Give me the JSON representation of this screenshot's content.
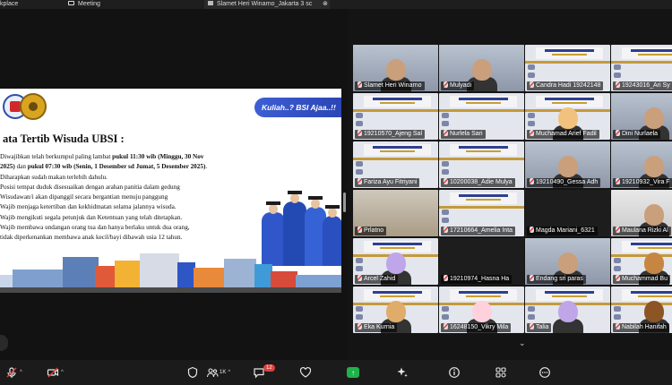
{
  "tabs": {
    "first_label": "kplace",
    "meeting_label": "Meeting",
    "share_label": "Slamet Heri Winarno_Jakarta 3 sc"
  },
  "slide": {
    "slogan": "Kuliah..? BSI Ajaa..!!",
    "title": "ata Tertib Wisuda UBSI :",
    "rules": [
      {
        "pre": "Diwajibkan telah berkumpul paling lambat ",
        "bold": "pukul 11:30 wib (Minggu, 30 Nov",
        "post": ""
      },
      {
        "pre": "",
        "bold": "2025)",
        "mid": " dan ",
        "bold2": "pukul 07:30 wib (Senin, 1 Desember sd Jumat, 5 Desember 2025)",
        "post": "."
      },
      {
        "pre": "Diharapkan sudah makan terlebih dahulu.",
        "bold": "",
        "post": ""
      },
      {
        "pre": "Posisi tempat duduk disesuaikan dengan arahan panitia dalam gedung",
        "bold": "",
        "post": ""
      },
      {
        "pre": "Wisudawan/i akan dipanggil secara bergantian menuju panggung",
        "bold": "",
        "post": ""
      },
      {
        "pre": "Wajib menjaga ketertiban dan kekhidmatan selama jalannya wisuda.",
        "bold": "",
        "post": ""
      },
      {
        "pre": "Wajib mengikuti segala petunjuk dan Ketentuan yang telah ditetapkan.",
        "bold": "",
        "post": ""
      },
      {
        "pre": "Wajib membawa undangan orang tua dan hanya berlaku untuk dua orang,",
        "bold": "",
        "post": ""
      },
      {
        "pre": "tidak diperkenankan membawa anak kecil/bayi dibawah usia 12 tahun.",
        "bold": "",
        "post": ""
      }
    ]
  },
  "participants": [
    {
      "name": "Slamet Heri Winarno",
      "kind": "person",
      "speaking": true
    },
    {
      "name": "Mulyadi",
      "kind": "person"
    },
    {
      "name": "Candra Hadi 19242148",
      "kind": "banner"
    },
    {
      "name": "19243016_Ari Sy",
      "kind": "banner"
    },
    {
      "name": "19210570_Ajeng Sal",
      "kind": "banner"
    },
    {
      "name": "Nurlela Sari",
      "kind": "banner"
    },
    {
      "name": "Muchamad Arief Fadil",
      "kind": "avatar"
    },
    {
      "name": "Dini Nurlaela",
      "kind": "person"
    },
    {
      "name": "Fariza Ayu Fitriyani",
      "kind": "banner"
    },
    {
      "name": "10200038_Adie Mulya",
      "kind": "banner"
    },
    {
      "name": "19210490_Gessa Adh",
      "kind": "person"
    },
    {
      "name": "19210932_Vira F",
      "kind": "person"
    },
    {
      "name": "Prlatno",
      "kind": "room"
    },
    {
      "name": "17210664_Amelia Inta",
      "kind": "banner"
    },
    {
      "name": "Magda Mariani_6321",
      "kind": "dark"
    },
    {
      "name": "Maulana Rizki Al",
      "kind": "headset"
    },
    {
      "name": "Arcel Zahid",
      "kind": "avatar"
    },
    {
      "name": "19210974_Hasna Ha",
      "kind": "dark"
    },
    {
      "name": "Endang sri paras",
      "kind": "person"
    },
    {
      "name": "Muchammad Bu",
      "kind": "avatar"
    },
    {
      "name": "Eka Kurnia",
      "kind": "avatar"
    },
    {
      "name": "16248150_Vikry Mila",
      "kind": "avatar"
    },
    {
      "name": "Talia",
      "kind": "avatar"
    },
    {
      "name": "Nabilah Hanifah",
      "kind": "avatar"
    }
  ],
  "toolbar": {
    "participants_count": "1K",
    "chat_badge": "12"
  },
  "colors": {
    "speaking_outline": "#2ecc71",
    "share_button": "#20b24a",
    "slogan_bg": "#3d5fd4",
    "badge": "#e2403c"
  }
}
